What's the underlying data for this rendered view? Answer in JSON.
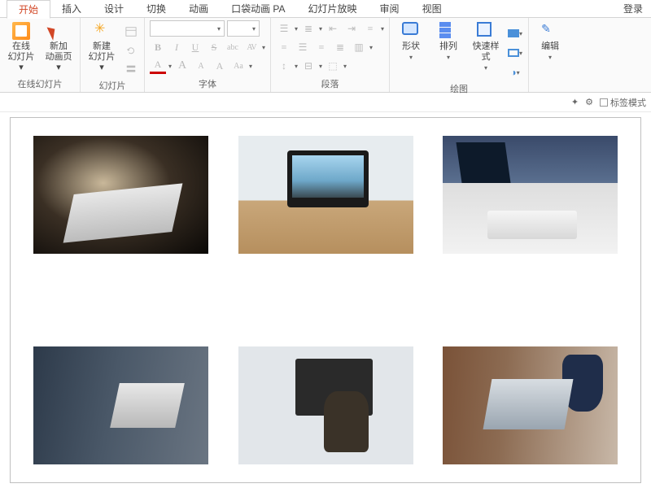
{
  "tabs": {
    "items": [
      "开始",
      "插入",
      "设计",
      "切换",
      "动画",
      "口袋动画 PA",
      "幻灯片放映",
      "审阅",
      "视图"
    ],
    "active_index": 0,
    "login": "登录"
  },
  "ribbon": {
    "group_online_slides": {
      "label": "在线幻灯片",
      "online": "在线\n幻灯片 ▾",
      "new_anim": "新加\n动画页 ▾"
    },
    "group_slides": {
      "label": "幻灯片",
      "new_slide": "新建\n幻灯片 ▾"
    },
    "group_font": {
      "label": "字体",
      "font_name_placeholder": "",
      "font_size_placeholder": "",
      "bold": "B",
      "italic": "I",
      "underline": "U",
      "strike": "S",
      "shadow": "abc",
      "char_space": "AV",
      "grow": "A",
      "shrink": "A",
      "clear": "A",
      "change_case": "Aa",
      "font_color": "A"
    },
    "group_para": {
      "label": "段落"
    },
    "group_draw": {
      "label": "绘图",
      "shapes": "形状",
      "arrange": "排列",
      "quick": "快速样式"
    },
    "group_edit": {
      "label": "编辑"
    }
  },
  "subbar": {
    "tag_mode": "标签模式"
  },
  "slide": {
    "images": [
      {
        "alt": "hands typing on laptop in dark"
      },
      {
        "alt": "imac on wooden desk by window"
      },
      {
        "alt": "dual monitors keyboard and mug"
      },
      {
        "alt": "people meeting with laptop"
      },
      {
        "alt": "woman working at desktop monitor"
      },
      {
        "alt": "woman with laptop and notebook"
      }
    ]
  }
}
